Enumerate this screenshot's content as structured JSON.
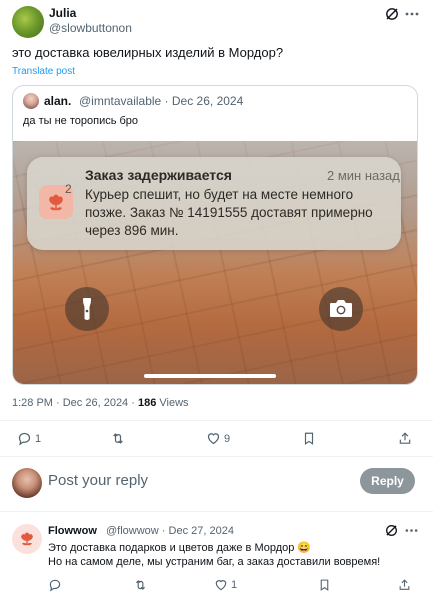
{
  "main_tweet": {
    "author_name": "Julia",
    "author_handle": "@slowbuttonon",
    "text": "это доставка ювелирных изделий в Мордор?",
    "translate_label": "Translate post"
  },
  "quoted_tweet": {
    "author_name": "alan.",
    "author_handle": "@imntavailable · Dec 26, 2024",
    "text": "да ты не торопись бро",
    "notification": {
      "badge": "2",
      "title": "Заказ задерживается",
      "time": "2 мин назад",
      "body": "Курьер спешит, но будет на месте немного позже. Заказ № 14191555 доставят примерно через 896 мин."
    }
  },
  "meta": {
    "time": "1:28 PM · Dec 26, 2024 · ",
    "views_count": "186",
    "views_label": " Views"
  },
  "actions": {
    "replies": "1",
    "reposts": "",
    "likes": "9"
  },
  "composer": {
    "placeholder": "Post your reply",
    "reply_button_label": "Reply"
  },
  "reply_tweet": {
    "author_name": "Flowwow",
    "author_handle": "@flowwow · Dec 27, 2024",
    "line1": "Это доставка подарков и цветов даже в Мордор 😄",
    "line2": "Но на самом деле, мы устраним баг, а заказ доставили вовремя!",
    "reply_count": "",
    "repost_count": "",
    "like_count": "1"
  },
  "colors": {
    "accent_link": "#1d9bf0",
    "reply_button_bg": "#8d969b",
    "secondary_text": "#536471"
  }
}
